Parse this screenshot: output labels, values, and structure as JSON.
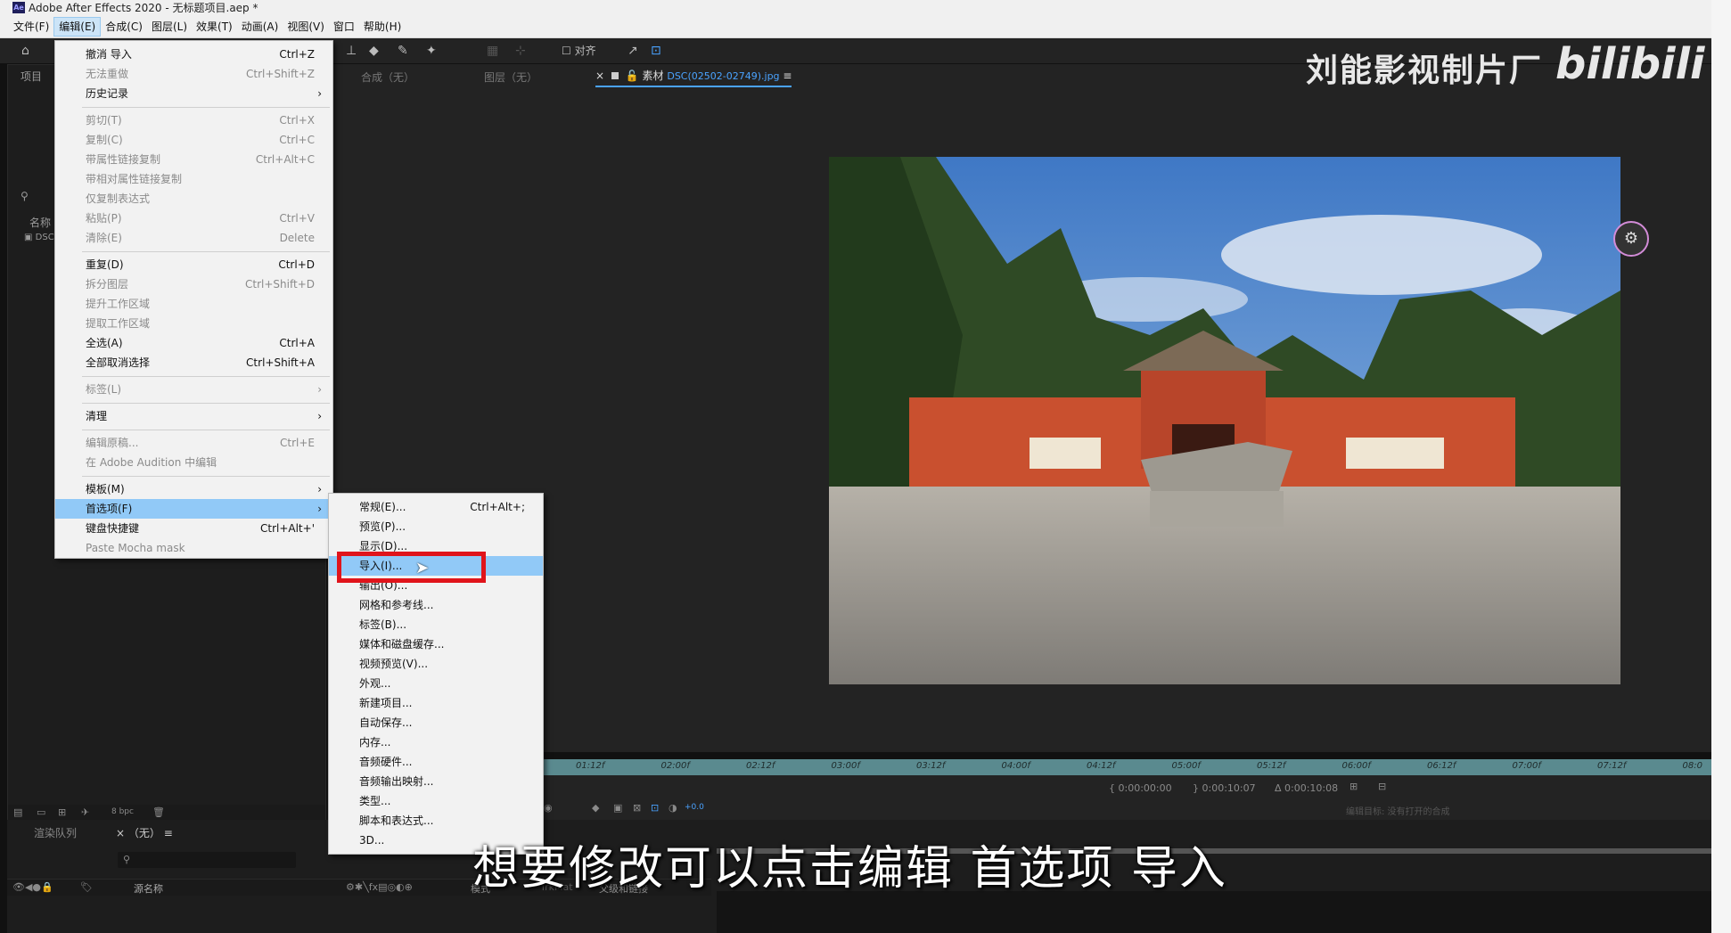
{
  "window": {
    "app_logo": "Ae",
    "title": "Adobe After Effects 2020 - 无标题项目.aep *"
  },
  "menubar": [
    "文件(F)",
    "编辑(E)",
    "合成(C)",
    "图层(L)",
    "效果(T)",
    "动画(A)",
    "视图(V)",
    "窗口",
    "帮助(H)"
  ],
  "toolbar": {
    "align_label": "对齐"
  },
  "panels": {
    "project_tab": "项目",
    "project_name_col": "名称",
    "project_item": "DSC",
    "composition_tab": "合成（无）",
    "layer_tab": "图层（无）",
    "footage_tab": "素材",
    "footage_file": "DSC(02502-02749).jpg",
    "bpc": "8 bpc"
  },
  "timecodes": {
    "start": "0:00:00:00",
    "end": "0:00:10:07",
    "duration": "Δ 0:00:10:08",
    "offset": "+0.0"
  },
  "ruler_ticks": [
    "01:12f",
    "02:00f",
    "02:12f",
    "03:00f",
    "03:12f",
    "04:00f",
    "04:12f",
    "05:00f",
    "05:12f",
    "06:00f",
    "06:12f",
    "07:00f",
    "07:12f",
    "08:0"
  ],
  "edit_target": "编辑目标: 没有打开的合成",
  "bottom": {
    "render_queue": "渲染队列",
    "comp_none": "（无）",
    "source_name": "源名称",
    "mode": "模式",
    "trkmat": "TrkMat",
    "parent": "父级和链接"
  },
  "edit_menu": [
    {
      "label": "撤消 导入",
      "shortcut": "Ctrl+Z"
    },
    {
      "label": "无法重做",
      "shortcut": "Ctrl+Shift+Z",
      "disabled": true
    },
    {
      "label": "历史记录",
      "submenu": true
    },
    {
      "sep": true
    },
    {
      "label": "剪切(T)",
      "shortcut": "Ctrl+X",
      "disabled": true
    },
    {
      "label": "复制(C)",
      "shortcut": "Ctrl+C",
      "disabled": true
    },
    {
      "label": "带属性链接复制",
      "shortcut": "Ctrl+Alt+C",
      "disabled": true
    },
    {
      "label": "带相对属性链接复制",
      "disabled": true
    },
    {
      "label": "仅复制表达式",
      "disabled": true
    },
    {
      "label": "粘贴(P)",
      "shortcut": "Ctrl+V",
      "disabled": true
    },
    {
      "label": "清除(E)",
      "shortcut": "Delete",
      "disabled": true
    },
    {
      "sep": true
    },
    {
      "label": "重复(D)",
      "shortcut": "Ctrl+D"
    },
    {
      "label": "拆分图层",
      "shortcut": "Ctrl+Shift+D",
      "disabled": true
    },
    {
      "label": "提升工作区域",
      "disabled": true
    },
    {
      "label": "提取工作区域",
      "disabled": true
    },
    {
      "label": "全选(A)",
      "shortcut": "Ctrl+A"
    },
    {
      "label": "全部取消选择",
      "shortcut": "Ctrl+Shift+A"
    },
    {
      "sep": true
    },
    {
      "label": "标签(L)",
      "submenu": true,
      "disabled": true
    },
    {
      "sep": true
    },
    {
      "label": "清理",
      "submenu": true
    },
    {
      "sep": true
    },
    {
      "label": "编辑原稿...",
      "shortcut": "Ctrl+E",
      "disabled": true
    },
    {
      "label": "在 Adobe Audition 中编辑",
      "disabled": true
    },
    {
      "sep": true
    },
    {
      "label": "模板(M)",
      "submenu": true
    },
    {
      "label": "首选项(F)",
      "submenu": true,
      "highlighted": true
    },
    {
      "label": "键盘快捷键",
      "shortcut": "Ctrl+Alt+'"
    },
    {
      "label": "Paste Mocha mask",
      "disabled": true
    }
  ],
  "prefs_menu": [
    {
      "label": "常规(E)...",
      "shortcut": "Ctrl+Alt+;"
    },
    {
      "label": "预览(P)..."
    },
    {
      "label": "显示(D)..."
    },
    {
      "label": "导入(I)...",
      "highlighted": true
    },
    {
      "label": "输出(O)..."
    },
    {
      "label": "网格和参考线..."
    },
    {
      "label": "标签(B)..."
    },
    {
      "label": "媒体和磁盘缓存..."
    },
    {
      "label": "视频预览(V)..."
    },
    {
      "label": "外观..."
    },
    {
      "label": "新建项目..."
    },
    {
      "label": "自动保存..."
    },
    {
      "label": "内存..."
    },
    {
      "label": "音频硬件..."
    },
    {
      "label": "音频输出映射..."
    },
    {
      "label": "类型..."
    },
    {
      "label": "脚本和表达式..."
    },
    {
      "label": "3D..."
    }
  ],
  "overlay": {
    "watermark": "刘能影视制片厂",
    "bilibili": "bilibili",
    "subtitle": "想要修改可以点击编辑 首选项 导入"
  },
  "colors": {
    "highlight": "#91c9f7",
    "annotation_box": "#e0141b",
    "ruler": "#5a8a8f"
  }
}
